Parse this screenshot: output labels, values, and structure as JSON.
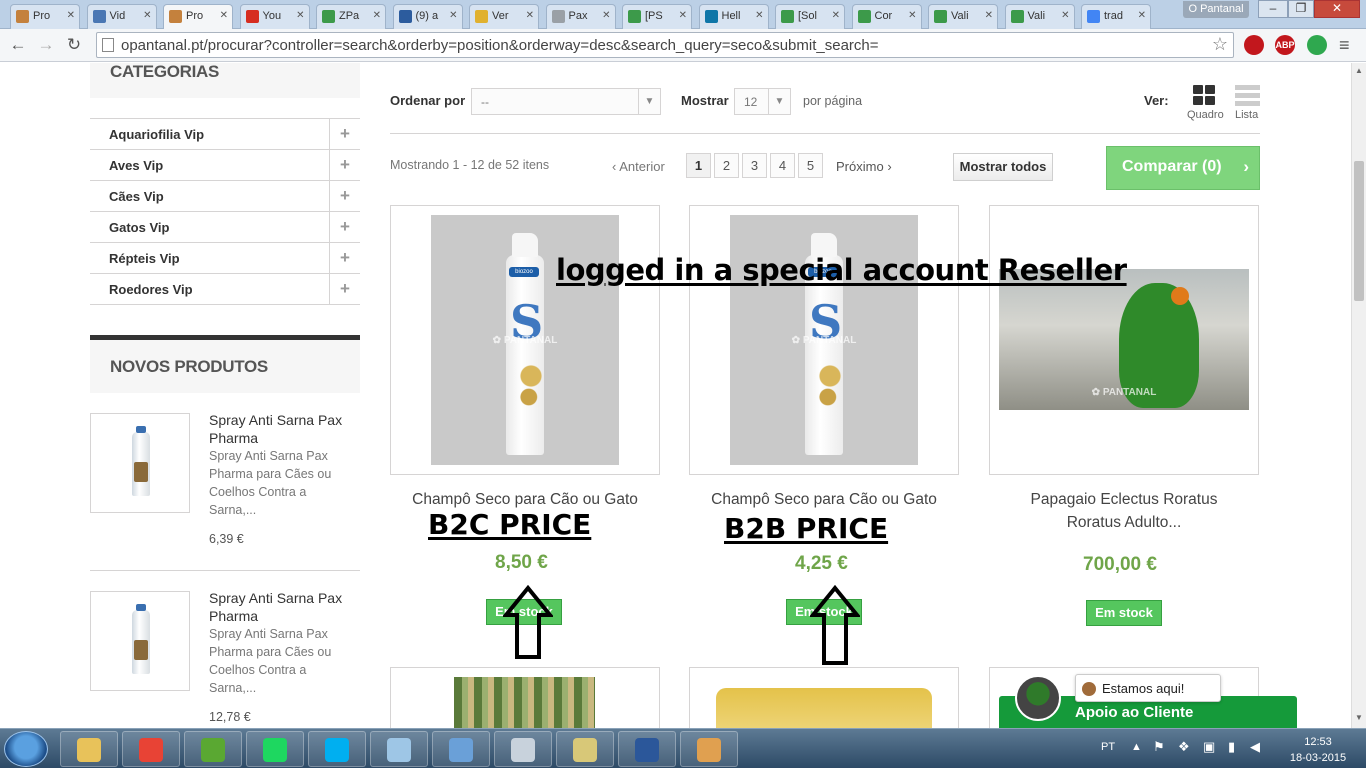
{
  "browser": {
    "tabs": [
      {
        "label": "Pro",
        "color": "#c4813d"
      },
      {
        "label": "Vid",
        "color": "#4a77b4"
      },
      {
        "label": "Pro",
        "color": "#c4813d",
        "active": true
      },
      {
        "label": "You",
        "color": "#d62d20"
      },
      {
        "label": "ZPa",
        "color": "#3c9a4a"
      },
      {
        "label": "(9) a",
        "color": "#2c5c9e"
      },
      {
        "label": "Ver",
        "color": "#e0b12f"
      },
      {
        "label": "Pax",
        "color": "#9aa0a6"
      },
      {
        "label": "[PS",
        "color": "#3c9a4a"
      },
      {
        "label": "Hell",
        "color": "#0e76a8"
      },
      {
        "label": "[Sol",
        "color": "#3c9a4a"
      },
      {
        "label": "Cor",
        "color": "#3c9a4a"
      },
      {
        "label": "Vali",
        "color": "#3c9a4a"
      },
      {
        "label": "Vali",
        "color": "#3c9a4a"
      },
      {
        "label": "trad",
        "color": "#4285f4"
      }
    ],
    "profile": "O Pantanal",
    "url": "opantanal.pt/procurar?controller=search&orderby=position&orderway=desc&search_query=seco&submit_search=",
    "extensions": [
      {
        "label": "",
        "color": "#c2171d"
      },
      {
        "label": "ABP",
        "color": "#c2171d"
      },
      {
        "label": "",
        "color": "#2fa84f"
      }
    ]
  },
  "sidebar": {
    "categories_title": "CATEGORIAS",
    "categories": [
      "Aquariofilia Vip",
      "Aves Vip",
      "Cães Vip",
      "Gatos Vip",
      "Répteis Vip",
      "Roedores Vip"
    ],
    "plus": "+",
    "new_products_title": "NOVOS PRODUTOS",
    "new_products": [
      {
        "name": "Spray Anti Sarna Pax Pharma",
        "desc": "Spray Anti Sarna Pax Pharma para Cães ou Coelhos Contra a Sarna,...",
        "price": "6,39 €"
      },
      {
        "name": "Spray Anti Sarna Pax Pharma",
        "desc": "Spray Anti Sarna Pax Pharma para Cães ou Coelhos Contra a Sarna,...",
        "price": "12,78 €"
      }
    ]
  },
  "controls": {
    "sort_label": "Ordenar por",
    "sort_value": "--",
    "show_label": "Mostrar",
    "show_value": "12",
    "per_page": "por página",
    "view_label": "Ver:",
    "view_grid": "Quadro",
    "view_list": "Lista"
  },
  "pagination": {
    "summary": "Mostrando 1 - 12 de 52 itens",
    "prev": "Anterior",
    "pages": [
      "1",
      "2",
      "3",
      "4",
      "5"
    ],
    "current": "1",
    "next": "Próximo",
    "show_all": "Mostrar todos",
    "compare": "Comparar (0)"
  },
  "products": [
    {
      "name": "Champô Seco para Cão ou Gato",
      "price": "8,50 €",
      "stock": "Em stock"
    },
    {
      "name": "Champô Seco para Cão ou Gato",
      "price": "4,25 €",
      "stock": "Em stock"
    },
    {
      "name": "Papagaio Eclectus Roratus Roratus Adulto...",
      "price": "700,00 €",
      "stock": "Em stock"
    }
  ],
  "annotations": {
    "headline": "logged in a special account Reseller",
    "b2c": "B2C PRICE",
    "b2b": "B2B PRICE"
  },
  "chat": {
    "bubble": "Estamos aqui!",
    "bar": "Apoio ao Cliente"
  },
  "taskbar": {
    "apps": [
      {
        "name": "explorer",
        "color": "#e8c25a"
      },
      {
        "name": "chrome",
        "color": "#e84335"
      },
      {
        "name": "utorrent",
        "color": "#5aa832"
      },
      {
        "name": "spotify",
        "color": "#1ed760"
      },
      {
        "name": "skype",
        "color": "#00aff0"
      },
      {
        "name": "notepad",
        "color": "#9ec6e6"
      },
      {
        "name": "photos",
        "color": "#6aa0d8"
      },
      {
        "name": "calculator",
        "color": "#c8d2dc"
      },
      {
        "name": "camera",
        "color": "#d8c878"
      },
      {
        "name": "word",
        "color": "#2b579a"
      },
      {
        "name": "paint",
        "color": "#e0a050"
      }
    ],
    "lang": "PT",
    "time": "12:53",
    "date": "18-03-2015"
  }
}
